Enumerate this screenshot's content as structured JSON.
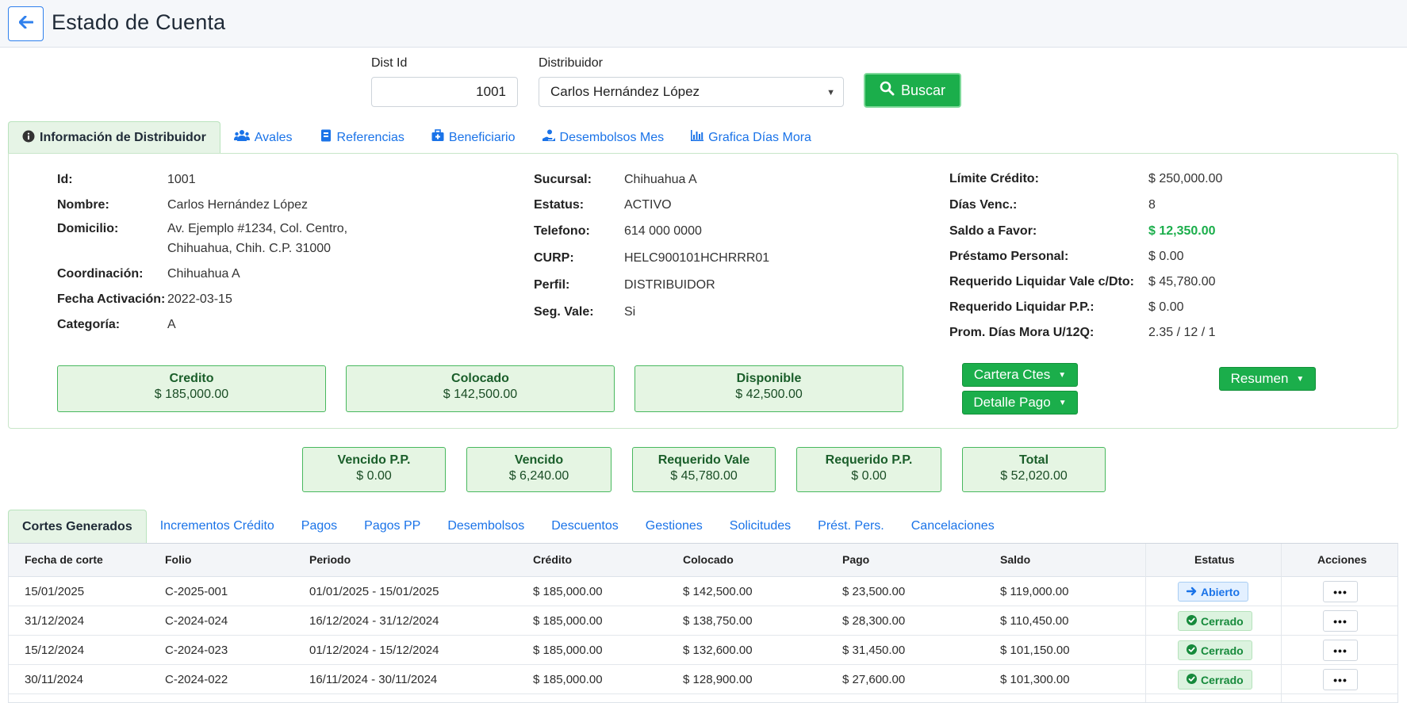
{
  "header": {
    "title": "Estado de Cuenta",
    "back_icon": "arrow-left-icon"
  },
  "search": {
    "dist_id_label": "Dist Id",
    "dist_id_value": "1001",
    "distribuidor_label": "Distribuidor",
    "distribuidor_value": "Carlos Hernández López",
    "buscar_label": "Buscar"
  },
  "top_tabs": [
    {
      "label": "Información de Distribuidor",
      "icon": "info-icon",
      "active": true
    },
    {
      "label": "Avales",
      "icon": "users-icon"
    },
    {
      "label": "Referencias",
      "icon": "contact-book-icon"
    },
    {
      "label": "Beneficiario",
      "icon": "medkit-icon"
    },
    {
      "label": "Desembolsos Mes",
      "icon": "hand-coin-icon"
    },
    {
      "label": "Grafica Días Mora",
      "icon": "bar-chart-icon"
    }
  ],
  "info": {
    "col1": [
      {
        "label": "Id:",
        "value": "1001"
      },
      {
        "label": "Nombre:",
        "value": "Carlos Hernández López"
      },
      {
        "label": "Domicilio:",
        "value": "Av. Ejemplo #1234, Col. Centro,",
        "value2": "Chihuahua, Chih. C.P. 31000"
      },
      {
        "label": "Coordinación:",
        "value": "Chihuahua A"
      },
      {
        "label": "Fecha Activación:",
        "value": "2022-03-15"
      },
      {
        "label": "Categoría:",
        "value": "A"
      }
    ],
    "col2": [
      {
        "label": "Sucursal:",
        "value": "Chihuahua A"
      },
      {
        "label": "Estatus:",
        "value": "ACTIVO"
      },
      {
        "label": "Telefono:",
        "value": "614 000 0000"
      },
      {
        "label": "CURP:",
        "value": "HELC900101HCHRRR01"
      },
      {
        "label": "Perfil:",
        "value": "DISTRIBUIDOR"
      },
      {
        "label": "Seg. Vale:",
        "value": "Si"
      }
    ],
    "col3": [
      {
        "label": "Límite Crédito:",
        "value": "$ 250,000.00"
      },
      {
        "label": "Días Venc.:",
        "value": "8"
      },
      {
        "label": "Saldo a Favor:",
        "value": "$ 12,350.00",
        "highlight": true
      },
      {
        "label": "Préstamo Personal:",
        "value": "$ 0.00"
      },
      {
        "label": "Requerido Liquidar Vale c/Dto:",
        "value": "$ 45,780.00"
      },
      {
        "label": "Requerido Liquidar P.P.:",
        "value": "$ 0.00"
      },
      {
        "label": "Prom. Días Mora U/12Q:",
        "value": "2.35 / 12 / 1"
      }
    ]
  },
  "credit_boxes": [
    {
      "title": "Credito",
      "value": "$ 185,000.00"
    },
    {
      "title": "Colocado",
      "value": "$ 142,500.00"
    },
    {
      "title": "Disponible",
      "value": "$ 42,500.00"
    }
  ],
  "dropdowns": {
    "cartera": "Cartera Ctes",
    "detalle": "Detalle Pago",
    "resumen": "Resumen"
  },
  "required_boxes": [
    {
      "title": "Vencido P.P.",
      "value": "$ 0.00"
    },
    {
      "title": "Vencido",
      "value": "$ 6,240.00"
    },
    {
      "title": "Requerido Vale",
      "value": "$ 45,780.00"
    },
    {
      "title": "Requerido P.P.",
      "value": "$ 0.00"
    },
    {
      "title": "Total",
      "value": "$ 52,020.00"
    }
  ],
  "bottom_tabs": [
    {
      "label": "Cortes Generados",
      "active": true
    },
    {
      "label": "Incrementos Crédito"
    },
    {
      "label": "Pagos"
    },
    {
      "label": "Pagos PP"
    },
    {
      "label": "Desembolsos"
    },
    {
      "label": "Descuentos"
    },
    {
      "label": "Gestiones"
    },
    {
      "label": "Solicitudes"
    },
    {
      "label": "Prést. Pers."
    },
    {
      "label": "Cancelaciones"
    }
  ],
  "table": {
    "columns": [
      "Fecha de corte",
      "Folio",
      "Periodo",
      "Crédito",
      "Colocado",
      "Pago",
      "Saldo",
      "Estatus",
      "Acciones"
    ],
    "rows": [
      {
        "fecha": "15/01/2025",
        "folio": "C-2025-001",
        "periodo": "01/01/2025 - 15/01/2025",
        "credito": "$ 185,000.00",
        "colocado": "$ 142,500.00",
        "pago": "$ 23,500.00",
        "saldo": "$ 119,000.00",
        "estatus": "Abierto",
        "estatus_type": "open",
        "accion": "•••"
      },
      {
        "fecha": "31/12/2024",
        "folio": "C-2024-024",
        "periodo": "16/12/2024 - 31/12/2024",
        "credito": "$ 185,000.00",
        "colocado": "$ 138,750.00",
        "pago": "$ 28,300.00",
        "saldo": "$ 110,450.00",
        "estatus": "Cerrado",
        "estatus_type": "closed",
        "accion": "•••"
      },
      {
        "fecha": "15/12/2024",
        "folio": "C-2024-023",
        "periodo": "01/12/2024 - 15/12/2024",
        "credito": "$ 185,000.00",
        "colocado": "$ 132,600.00",
        "pago": "$ 31,450.00",
        "saldo": "$ 101,150.00",
        "estatus": "Cerrado",
        "estatus_type": "closed",
        "accion": "•••"
      },
      {
        "fecha": "30/11/2024",
        "folio": "C-2024-022",
        "periodo": "16/11/2024 - 30/11/2024",
        "credito": "$ 185,000.00",
        "colocado": "$ 128,900.00",
        "pago": "$ 27,600.00",
        "saldo": "$ 101,300.00",
        "estatus": "Cerrado",
        "estatus_type": "closed",
        "accion": "•••"
      }
    ]
  },
  "colors": {
    "primary_green": "#1bae4b",
    "link_blue": "#1a73e8",
    "box_bg": "#e5f5e3"
  }
}
